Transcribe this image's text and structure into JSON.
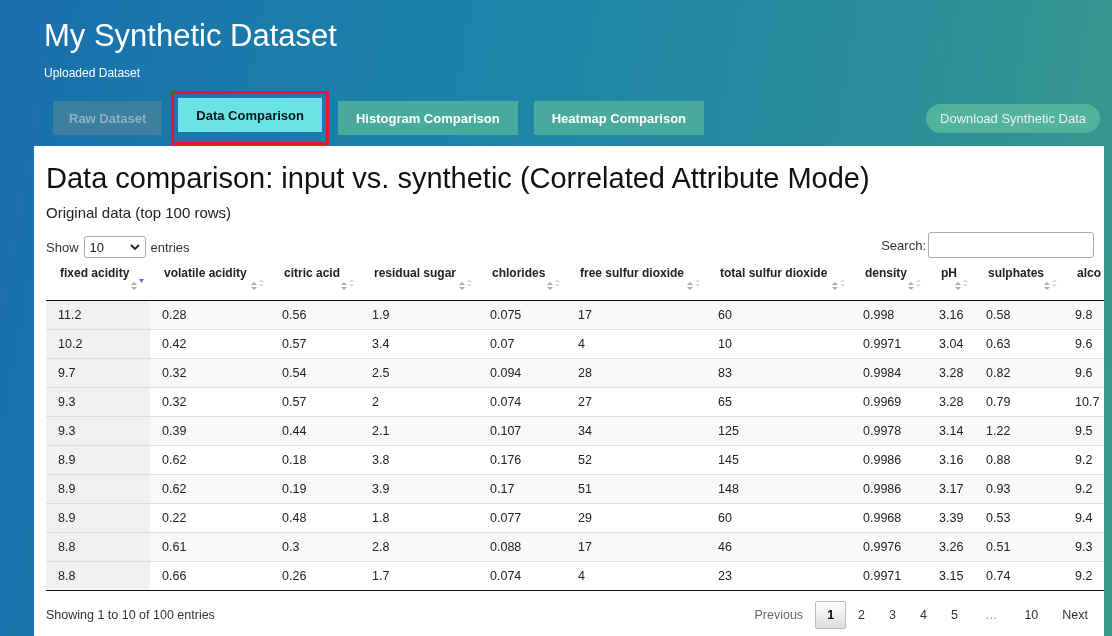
{
  "header": {
    "title": "My Synthetic Dataset",
    "subtitle": "Uploaded Dataset"
  },
  "tabs": [
    {
      "label": "Raw Dataset",
      "selected": false,
      "disabled": true,
      "highlighted": false
    },
    {
      "label": "Data Comparison",
      "selected": true,
      "disabled": false,
      "highlighted": true
    },
    {
      "label": "Histogram Comparison",
      "selected": false,
      "disabled": false,
      "highlighted": false
    },
    {
      "label": "Heatmap Comparison",
      "selected": false,
      "disabled": false,
      "highlighted": false
    }
  ],
  "download_button": "Download Synthetic Data",
  "panel": {
    "heading": "Data comparison: input vs. synthetic (Correlated Attribute Mode)",
    "subheading": "Original data (top 100 rows)"
  },
  "length_control": {
    "before": "Show",
    "value": "10",
    "after": "entries"
  },
  "search": {
    "label": "Search:"
  },
  "table": {
    "columns": [
      {
        "label": "fixed acidity",
        "sorted": true
      },
      {
        "label": "volatile acidity",
        "sorted": false
      },
      {
        "label": "citric acid",
        "sorted": false
      },
      {
        "label": "residual sugar",
        "sorted": false
      },
      {
        "label": "chlorides",
        "sorted": false
      },
      {
        "label": "free sulfur dioxide",
        "sorted": false
      },
      {
        "label": "total sulfur dioxide",
        "sorted": false
      },
      {
        "label": "density",
        "sorted": false
      },
      {
        "label": "pH",
        "sorted": false
      },
      {
        "label": "sulphates",
        "sorted": false
      },
      {
        "label": "alco"
      }
    ],
    "rows": [
      [
        "11.2",
        "0.28",
        "0.56",
        "1.9",
        "0.075",
        "17",
        "60",
        "0.998",
        "3.16",
        "0.58",
        "9.8"
      ],
      [
        "10.2",
        "0.42",
        "0.57",
        "3.4",
        "0.07",
        "4",
        "10",
        "0.9971",
        "3.04",
        "0.63",
        "9.6"
      ],
      [
        "9.7",
        "0.32",
        "0.54",
        "2.5",
        "0.094",
        "28",
        "83",
        "0.9984",
        "3.28",
        "0.82",
        "9.6"
      ],
      [
        "9.3",
        "0.32",
        "0.57",
        "2",
        "0.074",
        "27",
        "65",
        "0.9969",
        "3.28",
        "0.79",
        "10.7"
      ],
      [
        "9.3",
        "0.39",
        "0.44",
        "2.1",
        "0.107",
        "34",
        "125",
        "0.9978",
        "3.14",
        "1.22",
        "9.5"
      ],
      [
        "8.9",
        "0.62",
        "0.18",
        "3.8",
        "0.176",
        "52",
        "145",
        "0.9986",
        "3.16",
        "0.88",
        "9.2"
      ],
      [
        "8.9",
        "0.62",
        "0.19",
        "3.9",
        "0.17",
        "51",
        "148",
        "0.9986",
        "3.17",
        "0.93",
        "9.2"
      ],
      [
        "8.9",
        "0.22",
        "0.48",
        "1.8",
        "0.077",
        "29",
        "60",
        "0.9968",
        "3.39",
        "0.53",
        "9.4"
      ],
      [
        "8.8",
        "0.61",
        "0.3",
        "2.8",
        "0.088",
        "17",
        "46",
        "0.9976",
        "3.26",
        "0.51",
        "9.3"
      ],
      [
        "8.8",
        "0.66",
        "0.26",
        "1.7",
        "0.074",
        "4",
        "23",
        "0.9971",
        "3.15",
        "0.74",
        "9.2"
      ]
    ]
  },
  "info": "Showing 1 to 10 of 100 entries",
  "pagination": {
    "previous": "Previous",
    "next": "Next",
    "pages": [
      {
        "label": "1",
        "selected": true,
        "kind": "page"
      },
      {
        "label": "2",
        "selected": false,
        "kind": "page"
      },
      {
        "label": "3",
        "selected": false,
        "kind": "page"
      },
      {
        "label": "4",
        "selected": false,
        "kind": "page"
      },
      {
        "label": "5",
        "selected": false,
        "kind": "page"
      },
      {
        "label": "…",
        "selected": false,
        "kind": "ellipsis"
      },
      {
        "label": "10",
        "selected": false,
        "kind": "page"
      }
    ]
  }
}
